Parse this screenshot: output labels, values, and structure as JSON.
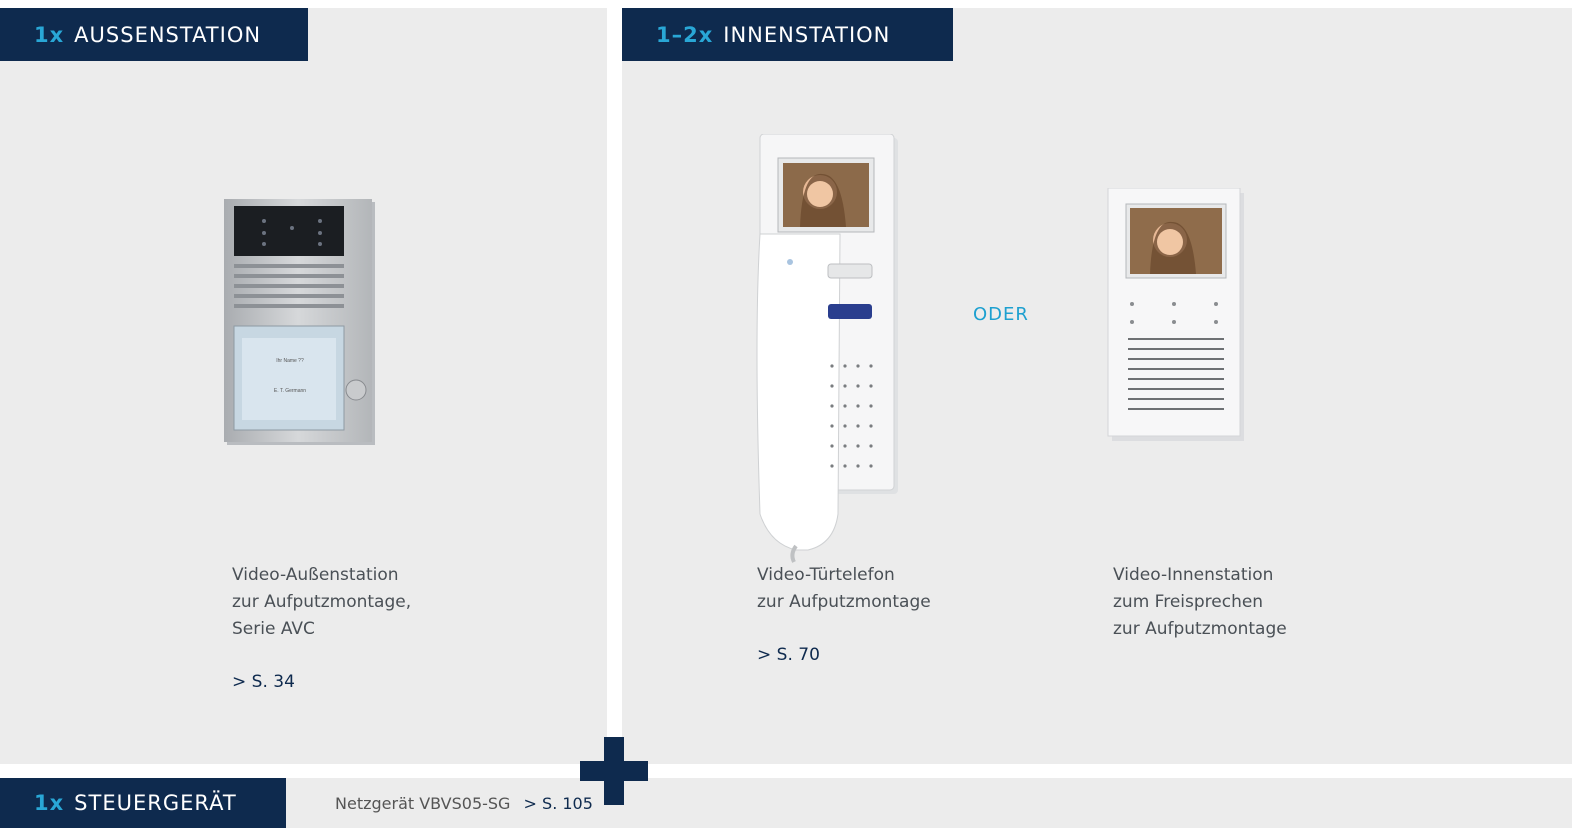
{
  "aussen": {
    "qty": "1x",
    "title": "AUSSENSTATION",
    "desc": [
      "Video-Außenstation",
      "zur Aufputzmontage,",
      "Serie AVC"
    ],
    "ref": "> S. 34",
    "label_name": "Ihr Name ??",
    "label_sub": "E. T. Germann"
  },
  "innen": {
    "qty": "1–2x",
    "title": "INNENSTATION",
    "oder": "ODER",
    "phone": {
      "desc": [
        "Video-Türtelefon",
        "zur Aufputzmontage"
      ],
      "ref": "> S. 70"
    },
    "hands_free": {
      "desc": [
        "Video-Innenstation",
        "zum Freisprechen",
        "zur Aufputzmontage"
      ]
    }
  },
  "steuer": {
    "qty": "1x",
    "title": "STEUERGERÄT",
    "device": "Netzgerät VBVS05-SG",
    "ref": "> S. 105"
  },
  "colors": {
    "navy": "#0e2a4e",
    "accent": "#29a7d6",
    "panel": "#ececec"
  }
}
